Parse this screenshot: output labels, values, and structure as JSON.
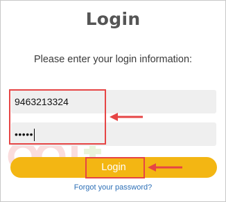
{
  "login": {
    "title": "Login",
    "subtitle": "Please enter your login information:",
    "username_value": "9463213324",
    "password_mask": "•••••",
    "submit_label": "Login",
    "forgot_link": "Forgot your password?"
  },
  "watermark": {
    "text": "9cat",
    "color": "#e8484a"
  },
  "colors": {
    "accent": "#f3b613",
    "annotation": "#e64545",
    "link": "#2d6fb6"
  },
  "icons": {
    "pointer_arrow": "arrow-left"
  }
}
